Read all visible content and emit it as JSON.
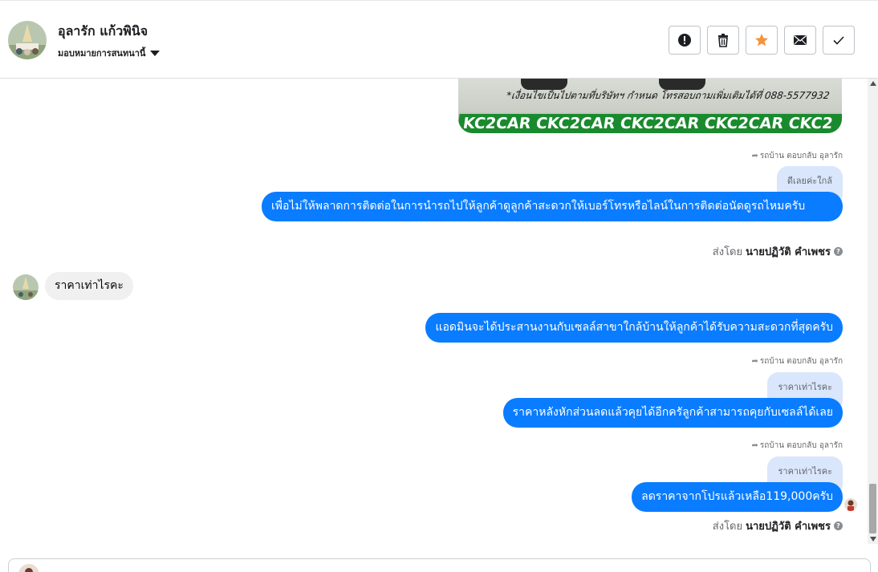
{
  "contact": {
    "name": "อุลารัก แก้วพินิจ",
    "assign_label": "มอบหมายการสนทนานี้"
  },
  "actions": [
    {
      "icon": "alert-icon",
      "color": "#1c1e21"
    },
    {
      "icon": "trash-icon",
      "color": "#1c1e21"
    },
    {
      "icon": "star-icon",
      "color": "#f7923b"
    },
    {
      "icon": "envelope-icon",
      "color": "#1c1e21"
    },
    {
      "icon": "check-icon",
      "color": "#1c1e21"
    }
  ],
  "ad_image": {
    "phone_text": "*เงื่อนไขเป็นไปตามที่บริษัทฯ กำหนด โทรสอบถามเพิ่มเติมได้ที่ 088-5577932",
    "banner_text": "KC2CAR CKC2CAR CKC2CAR CKC2CAR CKC2"
  },
  "messages": [
    {
      "reply_label": "รถบ้าน ตอบกลับ อุลารัก",
      "quote": "ดีเลยค่ะใกล้",
      "text": "เพื่อไม่ให้พลาดการติดต่อในการนำรถไปให้ลูกค้าดูลูกค้าสะดวกให้เบอร์โทรหรือไลน์ในการติดต่อนัดดูรถไหมครับ"
    },
    {
      "incoming_text": "ราคาเท่าไรคะ"
    },
    {
      "text": "แอดมินจะได้ประสานงานกับเซลล์สาขาใกล้บ้านให้ลูกค้าได้รับความสะดวกที่สุดครับ"
    },
    {
      "reply_label": "รถบ้าน ตอบกลับ อุลารัก",
      "quote": "ราคาเท่าไรคะ",
      "text": "ราคาหลังหักส่วนลดแล้วคุยได้อีกครัลูกค้าสามารถคุยกับเซลล์ได้เลย"
    },
    {
      "reply_label": "รถบ้าน ตอบกลับ อุลารัก",
      "quote": "ราคาเท่าไรคะ",
      "text": "ลดราคาจากโปรแล้วเหลือ119,000ครับ"
    }
  ],
  "sent_by": {
    "prefix": "ส่งโดย",
    "name": "นายปฏิวัติ คำเพชร",
    "help": "?"
  },
  "colors": {
    "outgoing_bubble": "#0a7cff",
    "incoming_bubble": "#f0f0f0",
    "quote_bubble": "#d9e6fb"
  }
}
